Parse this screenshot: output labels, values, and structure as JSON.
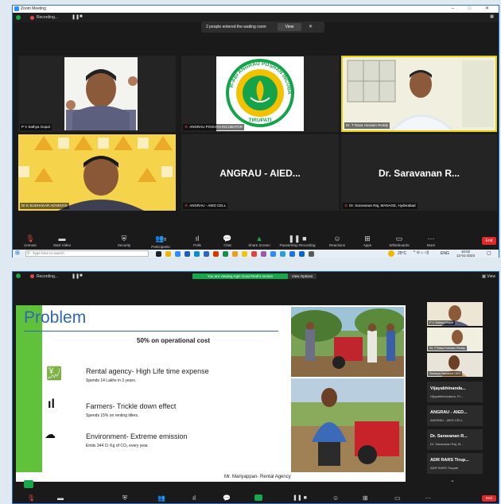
{
  "win1": {
    "title": "Zoom Meeting",
    "recording_label": "Recording...",
    "notice": {
      "text": "2 people entered the waiting room",
      "view_label": "View"
    },
    "tiles": [
      {
        "name": "P V Sathya Gopal"
      },
      {
        "name": "ANGRAU POSHAN INCUBATOR",
        "logo_lines": [
          "R-ABI ANGRAU POSHAN INCUBATOR",
          "TIRUPATI"
        ]
      },
      {
        "name": "Dr. T Rasa Hussain Reddy"
      },
      {
        "name": "Dr K SUDHAKAR ADVENTS"
      },
      {
        "name": "ANGRAU - AIED CELL",
        "big": "ANGRAU - AIED..."
      },
      {
        "name": "Dr. Saravanan Raj, MANAGE, Hyderabad",
        "big": "Dr. Saravanan R..."
      }
    ],
    "toolbar": {
      "items": [
        "Unmute",
        "Start Video",
        "Security",
        "Participants",
        "Polls",
        "Chat",
        "Share Screen",
        "Pause/Stop Recording",
        "Reactions",
        "Apps",
        "Whiteboards",
        "More"
      ],
      "participants_count": "8",
      "end_label": "End"
    },
    "taskbar": {
      "search_placeholder": "Type here to search",
      "temp": "25°C",
      "lang": "ENG",
      "time": "10:02",
      "date": "12-01-2023"
    }
  },
  "win2": {
    "recording_label": "Recording...",
    "banner": "You are viewing Agin Good Reel's screen",
    "view_options": "View Options",
    "view_label": "View",
    "slide": {
      "title": "Problem",
      "subtitle": "50% on operational cost",
      "points": [
        {
          "heading": "Rental agency- High Life time expense",
          "detail": "Spends 14 Lakhs in 3 years."
        },
        {
          "heading": "Farmers- Trickle down effect",
          "detail": "Spends 15% on renting tillers."
        },
        {
          "heading": "Environment- Extreme emission",
          "detail": "Emits 344 Cr Kg of CO₂ every year."
        }
      ],
      "caption": "Mr. Mariyappan-  Rental Agency"
    },
    "sidebar": [
      {
        "name": "P V Sathya Gopal"
      },
      {
        "name": "Dr. T Rasa Hussain Reddy"
      },
      {
        "name": "Saranya Nandhini CEO"
      },
      {
        "title": "Vijayabhinanda...",
        "sub": "Vijayabhinandana, Pr..."
      },
      {
        "title": "ANGRAU - AIED...",
        "sub": "ANGRAU - AIED CELL"
      },
      {
        "title": "Dr. Saravanan R...",
        "sub": "Dr. Saravanan Raj, M..."
      },
      {
        "title": "ADR RARS Tirup...",
        "sub": "ADR RARS Tirupati"
      }
    ],
    "end_label": "End"
  },
  "colors": {
    "zoom_green": "#1aa64a",
    "end_red": "#e02828",
    "slide_green": "#5fc23a",
    "slide_blue": "#2f66b5"
  }
}
